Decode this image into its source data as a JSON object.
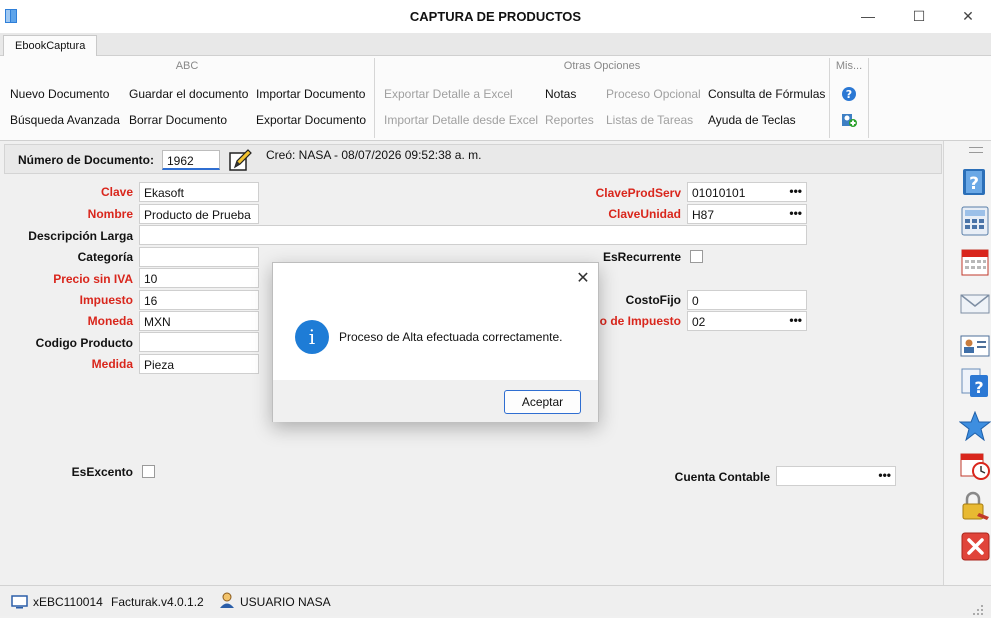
{
  "window": {
    "title": "CAPTURA DE PRODUCTOS",
    "min": "—",
    "max": "☐",
    "close": "✕"
  },
  "ribbon": {
    "tab": "EbookCaptura",
    "abc": {
      "title": "ABC",
      "nuevo": "Nuevo Documento",
      "guardar": "Guardar el documento",
      "importar": "Importar Documento",
      "busqueda": "Búsqueda Avanzada",
      "borrar": "Borrar Documento",
      "exportar": "Exportar Documento"
    },
    "otras": {
      "title": "Otras Opciones",
      "export_excel": "Exportar Detalle a Excel",
      "notas": "Notas",
      "proceso": "Proceso Opcional",
      "formulas": "Consulta de Fórmulas",
      "import_excel": "Importar Detalle desde Excel",
      "reportes": "Reportes",
      "tareas": "Listas de Tareas",
      "teclas": "Ayuda de Teclas"
    },
    "mis": {
      "title": "Mis..."
    }
  },
  "document": {
    "label": "Número de Documento:",
    "number": "1962",
    "created": "Creó: NASA - 08/07/2026 09:52:38 a. m."
  },
  "form": {
    "clave": {
      "label": "Clave",
      "value": "Ekasoft"
    },
    "nombre": {
      "label": "Nombre",
      "value": "Producto de Prueba"
    },
    "descripcion": {
      "label": "Descripción Larga",
      "value": ""
    },
    "categoria": {
      "label": "Categoría",
      "value": ""
    },
    "precio": {
      "label": "Precio sin IVA",
      "value": "10"
    },
    "impuesto": {
      "label": "Impuesto",
      "value": "16"
    },
    "moneda": {
      "label": "Moneda",
      "value": "MXN"
    },
    "codigo": {
      "label": "Codigo Producto",
      "value": ""
    },
    "medida": {
      "label": "Medida",
      "value": "Pieza"
    },
    "esexcento": {
      "label": "EsExcento"
    },
    "claveprodserv": {
      "label": "ClaveProdServ",
      "value": "01010101"
    },
    "claveunidad": {
      "label": "ClaveUnidad",
      "value": "H87"
    },
    "esrecurrente": {
      "label": "EsRecurrente"
    },
    "costofijo": {
      "label": "CostoFijo",
      "value": "0"
    },
    "objimpuesto": {
      "label": "o de Impuesto",
      "value": "02"
    },
    "cuenta": {
      "label": "Cuenta Contable",
      "value": ""
    },
    "ellipsis": "•••"
  },
  "dialog": {
    "close": "✕",
    "info": "i",
    "message": "Proceso de Alta efectuada correctamente.",
    "ok": "Aceptar"
  },
  "status": {
    "code": "xEBC110014",
    "version": "Facturak.v4.0.1.2",
    "user": "USUARIO NASA"
  },
  "colors": {
    "required": "#d9261c",
    "accent": "#1e7cd6",
    "button_border": "#2f6ed1"
  },
  "icons": [
    "book-icon",
    "help-circle-icon",
    "user-add-icon",
    "edit-pencil-icon",
    "help-book-icon",
    "calculator-icon",
    "calendar-icon",
    "mail-icon",
    "contact-card-icon",
    "help-document-icon",
    "star-icon",
    "calendar-clock-icon",
    "lock-key-icon",
    "close-red-icon",
    "user-icon",
    "monitor-icon"
  ]
}
